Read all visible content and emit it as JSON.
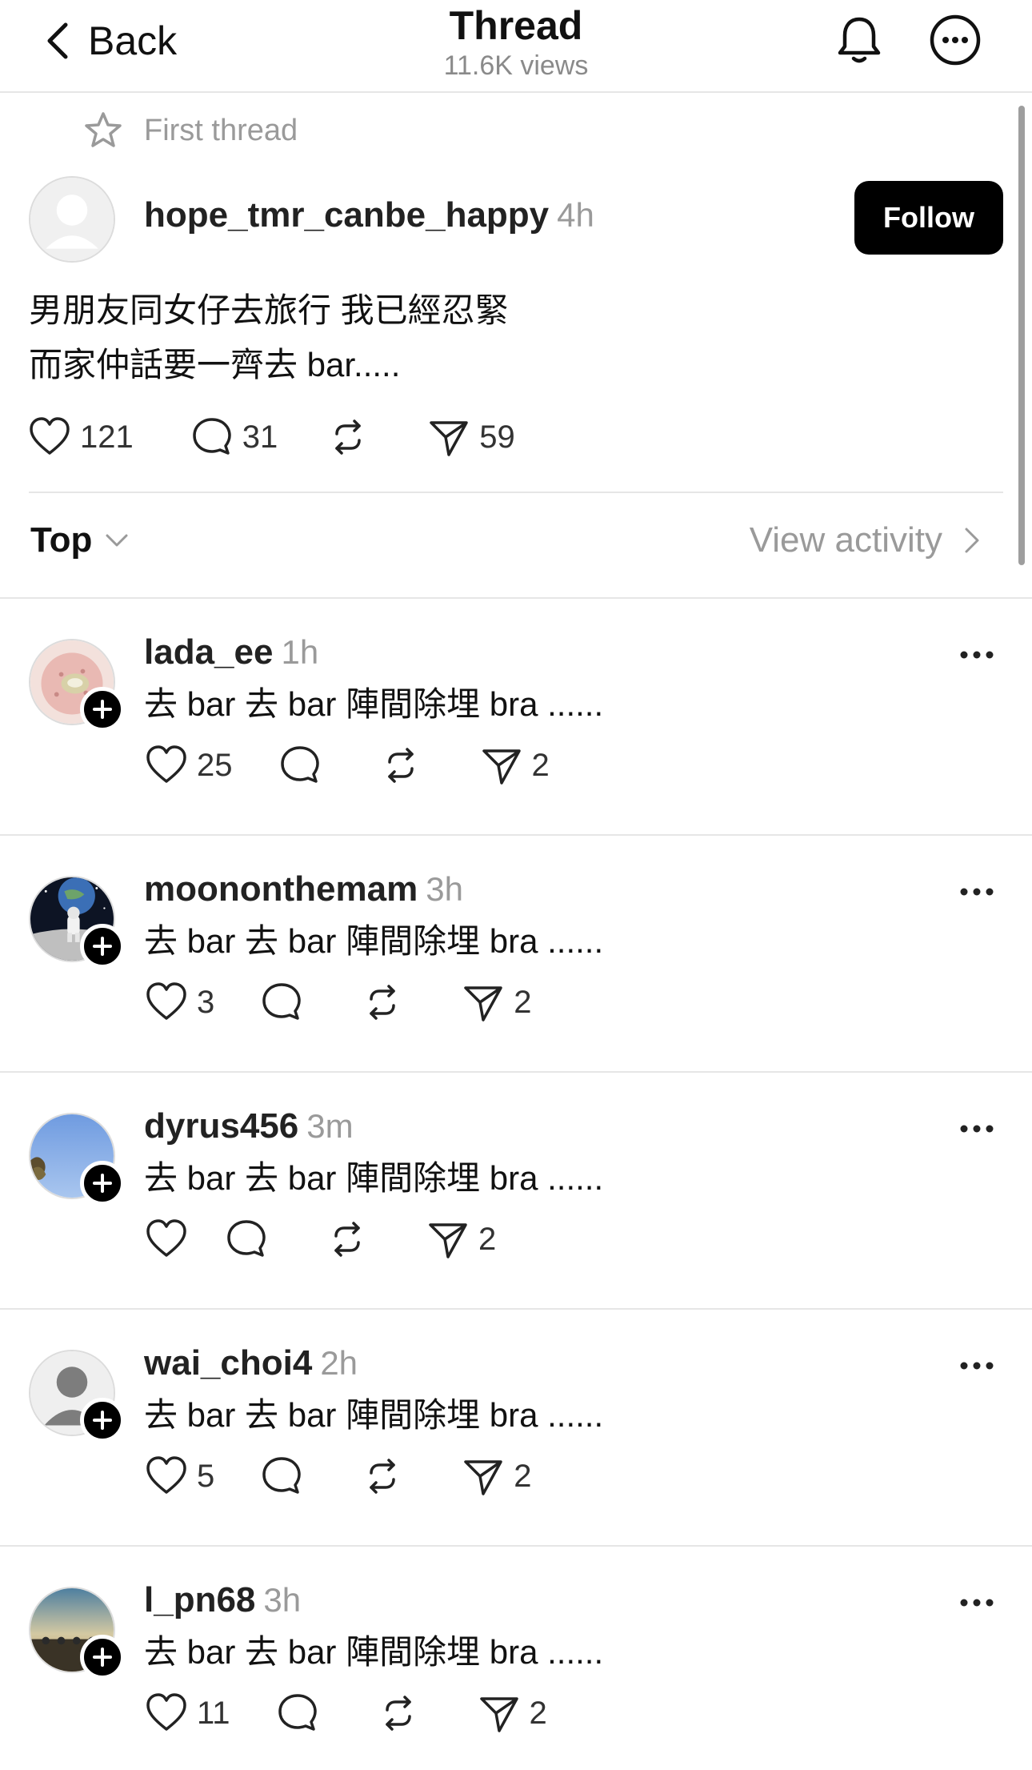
{
  "header": {
    "back_label": "Back",
    "title": "Thread",
    "views": "11.6K views",
    "icons": [
      "bell-icon",
      "more-circle-icon"
    ]
  },
  "main_post": {
    "tag": "First thread",
    "username": "hope_tmr_canbe_happy",
    "time": "4h",
    "follow_label": "Follow",
    "text_line1": "男朋友同女仔去旅行 我已經忍緊",
    "text_line2": "而家仲話要一齊去 bar.....",
    "likes": "121",
    "comments": "31",
    "shares": "59"
  },
  "sort": {
    "label": "Top",
    "view_activity": "View activity"
  },
  "replies": [
    {
      "username": "lada_ee",
      "time": "1h",
      "text": "去 bar 去 bar 陣間除埋 bra ......",
      "likes": "25",
      "shares": "2",
      "avatar": "donut-photo"
    },
    {
      "username": "moononthemam",
      "time": "3h",
      "text": "去 bar 去 bar 陣間除埋 bra ......",
      "likes": "3",
      "shares": "2",
      "avatar": "astronaut-moon-photo"
    },
    {
      "username": "dyrus456",
      "time": "3m",
      "text": "去 bar 去 bar 陣間除埋 bra ......",
      "likes": "",
      "shares": "2",
      "avatar": "blue-sky-photo"
    },
    {
      "username": "wai_choi4",
      "time": "2h",
      "text": "去 bar 去 bar 陣間除埋 bra ......",
      "likes": "5",
      "shares": "2",
      "avatar": "default-avatar"
    },
    {
      "username": "l_pn68",
      "time": "3h",
      "text": "去 bar 去 bar 陣間除埋 bra ......",
      "likes": "11",
      "shares": "2",
      "avatar": "sunset-photo"
    }
  ]
}
